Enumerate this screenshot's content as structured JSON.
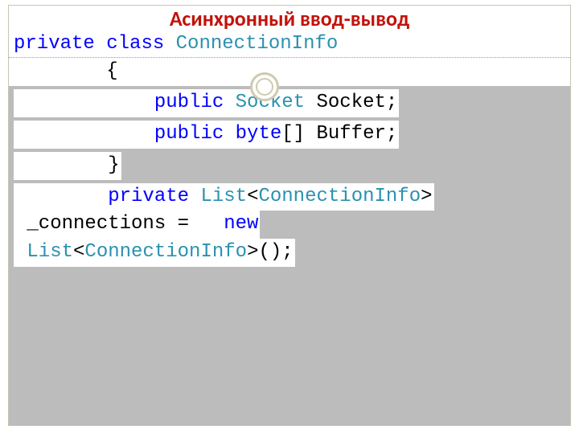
{
  "title": "Асинхронный ввод-вывод",
  "code": {
    "l1": {
      "t1": "private",
      "t2": " ",
      "t3": "class",
      "t4": " ",
      "t5": "ConnectionInfo"
    },
    "l2": "        {",
    "l3": {
      "pre": "            ",
      "t1": "public",
      "t2": " ",
      "t3": "Socket",
      "t4": " Socket;"
    },
    "l4": {
      "pre": "            ",
      "t1": "public",
      "t2": " ",
      "t3": "byte",
      "t4": "[] Buffer;"
    },
    "l5": {
      "pre": "        ",
      "body": "}"
    },
    "l6": {
      "pre": "        ",
      "t1": "private",
      "t2": " ",
      "t3": "List",
      "t4": "<",
      "t5": "ConnectionInfo",
      "t6": ">"
    },
    "l7": {
      "a": " _connections =   ",
      "t1": "new"
    },
    "l8": {
      "a": " ",
      "t1": "List",
      "t2": "<",
      "t3": "ConnectionInfo",
      "t4": ">();"
    }
  }
}
